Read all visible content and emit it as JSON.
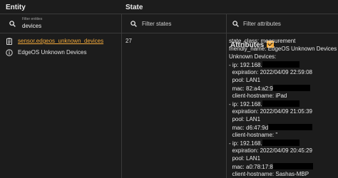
{
  "header": {
    "entity": "Entity",
    "state": "State",
    "attributes": "Attributes",
    "attributes_checked": true
  },
  "filters": {
    "entity": {
      "label": "Filter entities",
      "value": "devices"
    },
    "state": {
      "placeholder": "Filter states"
    },
    "attributes": {
      "placeholder": "Filter attributes"
    }
  },
  "row": {
    "entity_id": "sensor.edgeos_unknown_devices",
    "friendly_name": "EdgeOS Unknown Devices",
    "state": "27",
    "attributes": [
      "state_class: measurement",
      "friendly_name: EdgeOS Unknown Devices",
      "Unknown Devices:",
      "- ip: 192.168.",
      "  expiration: 2022/04/09 22:59:08",
      "  pool: LAN1",
      "  mac: 82:a4:a2:9",
      "  client-hostname: iPad",
      "- ip: 192.168.",
      "  expiration: 2022/04/09 21:05:39",
      "  pool: LAN1",
      "  mac: d6:47:9d",
      "  client-hostname: ''",
      "- ip: 192.168.",
      "  expiration: 2022/04/09 20:45:29",
      "  pool: LAN1",
      "  mac: a0:78:17:8",
      "  client-hostname: Sashas-MBP"
    ]
  },
  "icons": {
    "search": "search-icon",
    "entity": "clipboard-icon",
    "info": "info-icon"
  },
  "colors": {
    "background": "#1c1c1c",
    "accent": "#f2a93b",
    "divider": "#3a3a3a"
  }
}
